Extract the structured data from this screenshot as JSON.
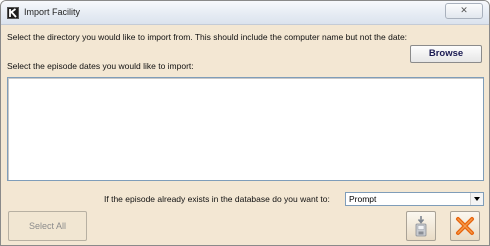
{
  "window": {
    "title": "Import Facility",
    "close_glyph": "✕"
  },
  "labels": {
    "directory_prompt": "Select the directory you would like to import from. This should include the computer name but not the date:",
    "episode_dates_prompt": "Select the episode dates you would like to import:",
    "exists_prompt": "If the episode already exists in the database do you want to:"
  },
  "buttons": {
    "browse": "Browse",
    "select_all": "Select All"
  },
  "episode_dates": [],
  "exists_action": {
    "selected": "Prompt"
  },
  "icons": {
    "app": "app-k-icon",
    "import": "import-disk-icon",
    "cancel": "cancel-x-icon"
  },
  "colors": {
    "dialog_background": "#f3e7d3",
    "cancel_icon": "#e8640c",
    "browse_text": "#1a1a52",
    "disabled_text": "#8c8c8c"
  }
}
